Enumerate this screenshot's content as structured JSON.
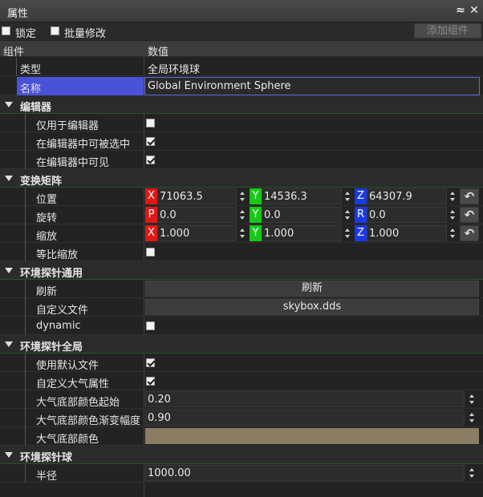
{
  "window": {
    "title": "属性"
  },
  "toolbar": {
    "lock_label": "锁定",
    "batch_label": "批量修改",
    "add_component_label": "添加组件"
  },
  "header": {
    "col_component": "组件",
    "col_value": "数值"
  },
  "general": {
    "type_label": "类型",
    "type_value": "全局环境球",
    "name_label": "名称",
    "name_value": "Global Environment Sphere"
  },
  "editor": {
    "title": "编辑器",
    "editor_only_label": "仅用于编辑器",
    "editor_only": false,
    "selectable_label": "在编辑器中可被选中",
    "selectable": true,
    "visible_label": "在编辑器中可见",
    "visible": true
  },
  "transform": {
    "title": "变换矩阵",
    "position_label": "位置",
    "rotation_label": "旋转",
    "scale_label": "缩放",
    "uniform_scale_label": "等比缩放",
    "axis_x": "X",
    "axis_y": "Y",
    "axis_z": "Z",
    "axis_p": "P",
    "axis_r": "R",
    "position": {
      "x": "71063.5",
      "y": "14536.3",
      "z": "64307.9"
    },
    "rotation": {
      "p": "0.0",
      "y": "0.0",
      "r": "0.0"
    },
    "scale": {
      "x": "1.000",
      "y": "1.000",
      "z": "1.000"
    },
    "uniform_scale": false
  },
  "probe_common": {
    "title": "环境探针通用",
    "refresh_label": "刷新",
    "refresh_button": "刷新",
    "custom_file_label": "自定义文件",
    "custom_file_value": "skybox.dds",
    "dynamic_label": "dynamic",
    "dynamic": false
  },
  "probe_global": {
    "title": "环境探针全局",
    "use_default_file_label": "使用默认文件",
    "use_default_file": true,
    "custom_atmo_label": "自定义大气属性",
    "custom_atmo": true,
    "atmo_bottom_start_label": "大气底部颜色起始",
    "atmo_bottom_start_value": "0.20",
    "atmo_bottom_gradient_label": "大气底部颜色渐变幅度",
    "atmo_bottom_gradient_value": "0.90",
    "atmo_bottom_color_label": "大气底部颜色",
    "atmo_bottom_color": "#8b7d64"
  },
  "probe_sphere": {
    "title": "环境探针球",
    "radius_label": "半径",
    "radius_value": "1000.00"
  }
}
